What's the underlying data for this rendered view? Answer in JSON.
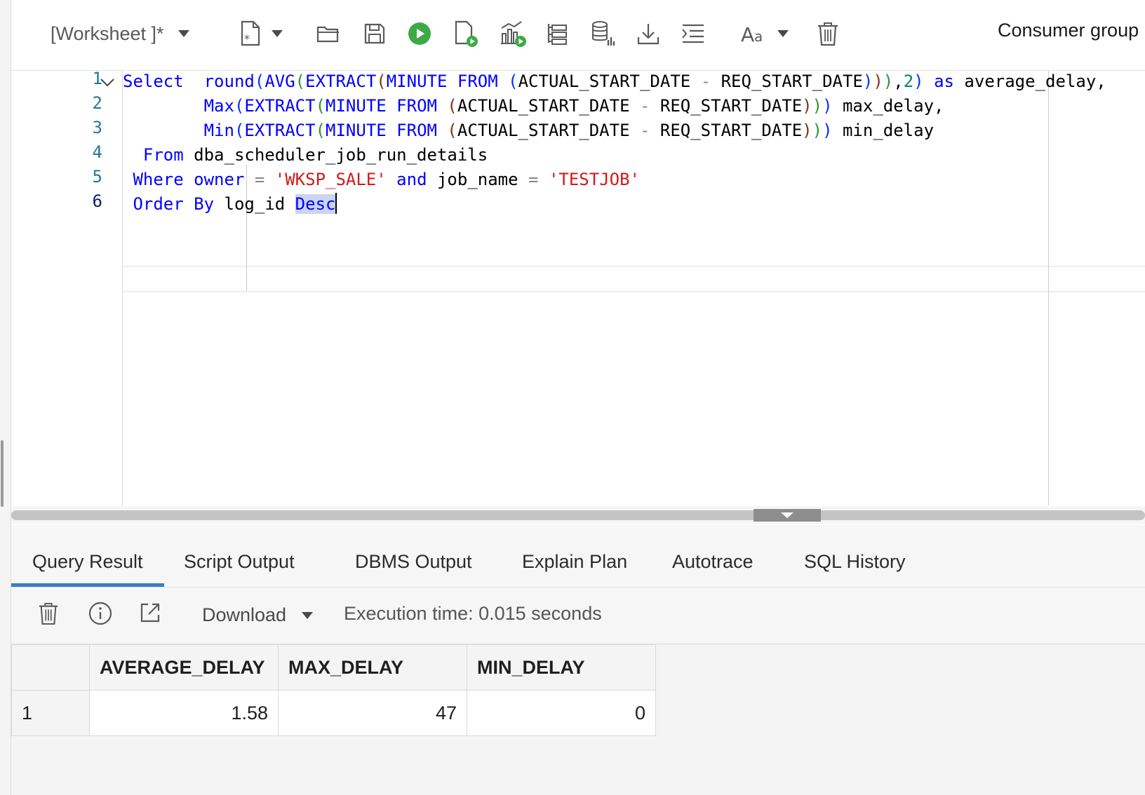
{
  "toolbar": {
    "worksheet_label": "[Worksheet ]*",
    "consumer_group_label": "Consumer group",
    "icons": [
      "new-file-icon",
      "open-folder-icon",
      "save-icon",
      "run-statement-icon",
      "run-script-icon",
      "explain-plan-icon",
      "autotrace-icon",
      "sql-tuning-icon",
      "download-icon",
      "format-icon",
      "font-size-icon",
      "clear-icon"
    ],
    "accent_colors": {
      "run_green": "#3daa47"
    }
  },
  "editor": {
    "line_numbers": [
      "1",
      "2",
      "3",
      "4",
      "5",
      "6"
    ],
    "active_line": "6",
    "code": {
      "line1": {
        "kw_select": "Select",
        "fn_round": "round",
        "fn_avg": "AVG",
        "fn_extract": "EXTRACT",
        "kw_minute": "MINUTE",
        "kw_from": "FROM",
        "col_actual": "ACTUAL_START_DATE",
        "op_minus": "-",
        "col_req": "REQ_START_DATE",
        "num_2": "2",
        "kw_as": "as",
        "alias": "average_delay,"
      },
      "line2": {
        "fn_max": "Max",
        "fn_extract": "EXTRACT",
        "kw_minute": "MINUTE",
        "kw_from": "FROM",
        "col_actual": "ACTUAL_START_DATE",
        "op_minus": "-",
        "col_req": "REQ_START_DATE",
        "alias": "max_delay,"
      },
      "line3": {
        "fn_min": "Min",
        "fn_extract": "EXTRACT",
        "kw_minute": "MINUTE",
        "kw_from": "FROM",
        "col_actual": "ACTUAL_START_DATE",
        "op_minus": "-",
        "col_req": "REQ_START_DATE",
        "alias": "min_delay"
      },
      "line4": {
        "kw_from": "From",
        "table": "dba_scheduler_job_run_details"
      },
      "line5": {
        "kw_where": "Where",
        "kw_owner": "owner",
        "op_eq": "=",
        "str_owner": "'WKSP_SALE'",
        "kw_and": "and",
        "col_job": "job_name",
        "op_eq2": "=",
        "str_job": "'TESTJOB'"
      },
      "line6": {
        "kw_order": "Order",
        "kw_by": "By",
        "col_log": "log_id",
        "kw_desc": "Desc"
      }
    }
  },
  "tabs": [
    {
      "label": "Query Result",
      "active": true
    },
    {
      "label": "Script Output",
      "active": false
    },
    {
      "label": "DBMS Output",
      "active": false
    },
    {
      "label": "Explain Plan",
      "active": false
    },
    {
      "label": "Autotrace",
      "active": false
    },
    {
      "label": "SQL History",
      "active": false
    }
  ],
  "result_toolbar": {
    "download_label": "Download",
    "execution_time": "Execution time: 0.015 seconds"
  },
  "result_grid": {
    "columns": [
      "AVERAGE_DELAY",
      "MAX_DELAY",
      "MIN_DELAY"
    ],
    "rows": [
      {
        "row_number": "1",
        "cells": [
          "1.58",
          "47",
          "0"
        ]
      }
    ]
  }
}
